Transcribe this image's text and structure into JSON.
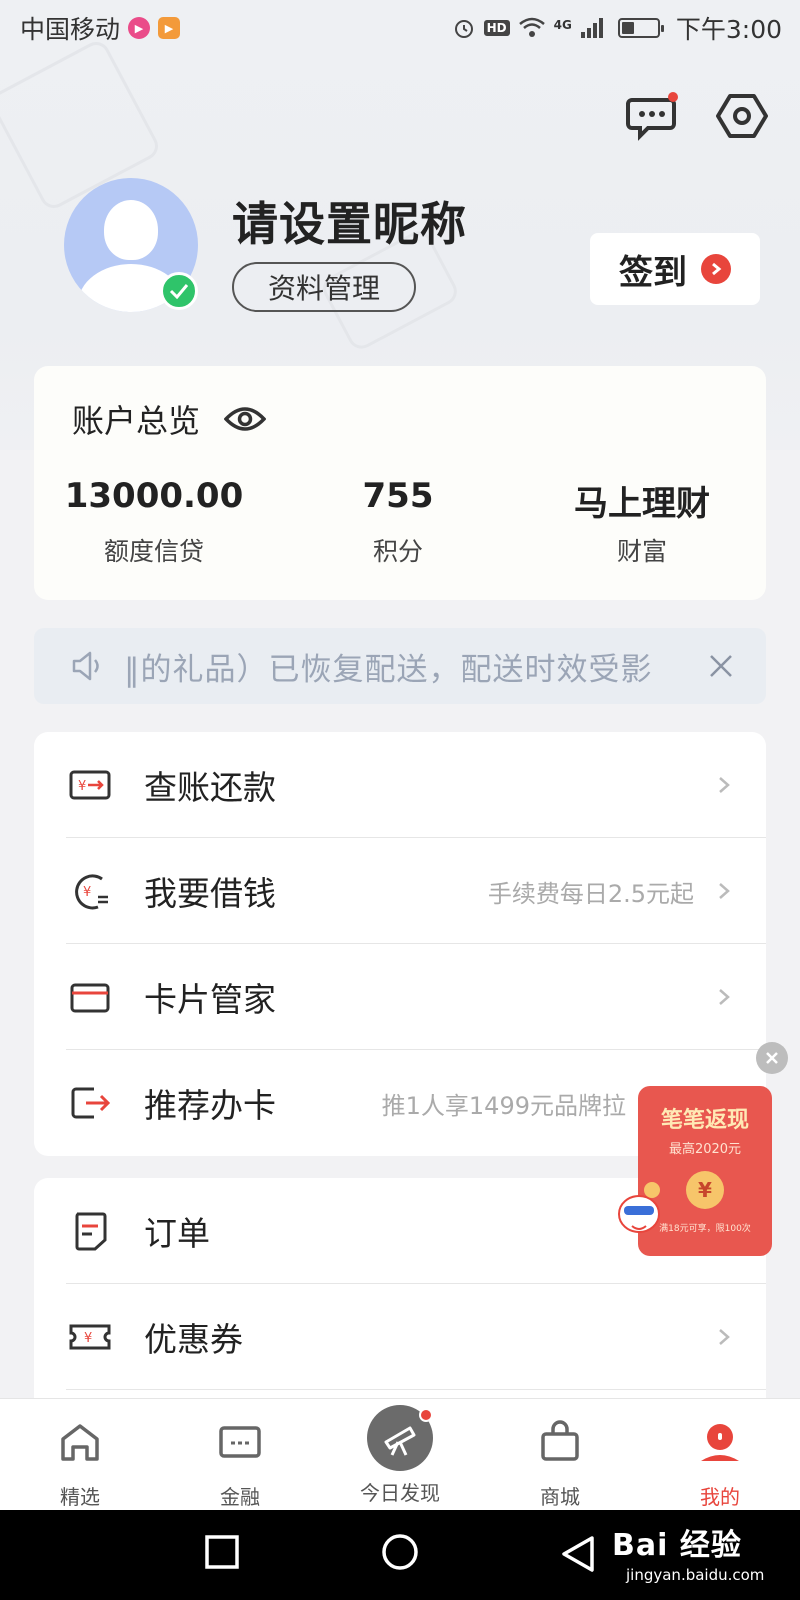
{
  "statusbar": {
    "carrier": "中国移动",
    "network": "4G",
    "hd": "HD",
    "time": "下午3:00"
  },
  "header": {
    "nickname": "请设置昵称",
    "profile_button": "资料管理",
    "signin_button": "签到"
  },
  "account": {
    "title": "账户总览",
    "items": [
      {
        "value": "13000.00",
        "label": "额度信贷"
      },
      {
        "value": "755",
        "label": "积分"
      },
      {
        "value": "马上理财",
        "label": "财富"
      }
    ]
  },
  "notice": {
    "text": "‖的礼品）已恢复配送，配送时效受影"
  },
  "menu1": [
    {
      "label": "查账还款",
      "hint": ""
    },
    {
      "label": "我要借钱",
      "hint": "手续费每日2.5元起"
    },
    {
      "label": "卡片管家",
      "hint": ""
    },
    {
      "label": "推荐办卡",
      "hint": "推1人享1499元品牌拉"
    }
  ],
  "menu2": [
    {
      "label": "订单",
      "hint": ""
    },
    {
      "label": "优惠券",
      "hint": ""
    }
  ],
  "promo": {
    "title": "笔笔返现",
    "subtitle": "最高2020元",
    "coin": "¥",
    "footer": "满18元可享，限100次"
  },
  "tabs": [
    {
      "label": "精选"
    },
    {
      "label": "金融"
    },
    {
      "label": "今日发现"
    },
    {
      "label": "商城"
    },
    {
      "label": "我的"
    }
  ],
  "watermark": {
    "main": "Bai 经验",
    "sub": "jingyan.baidu.com"
  },
  "colors": {
    "accent": "#e8453c",
    "verified": "#2fc46a",
    "avatar_bg": "#b6c9f5"
  }
}
